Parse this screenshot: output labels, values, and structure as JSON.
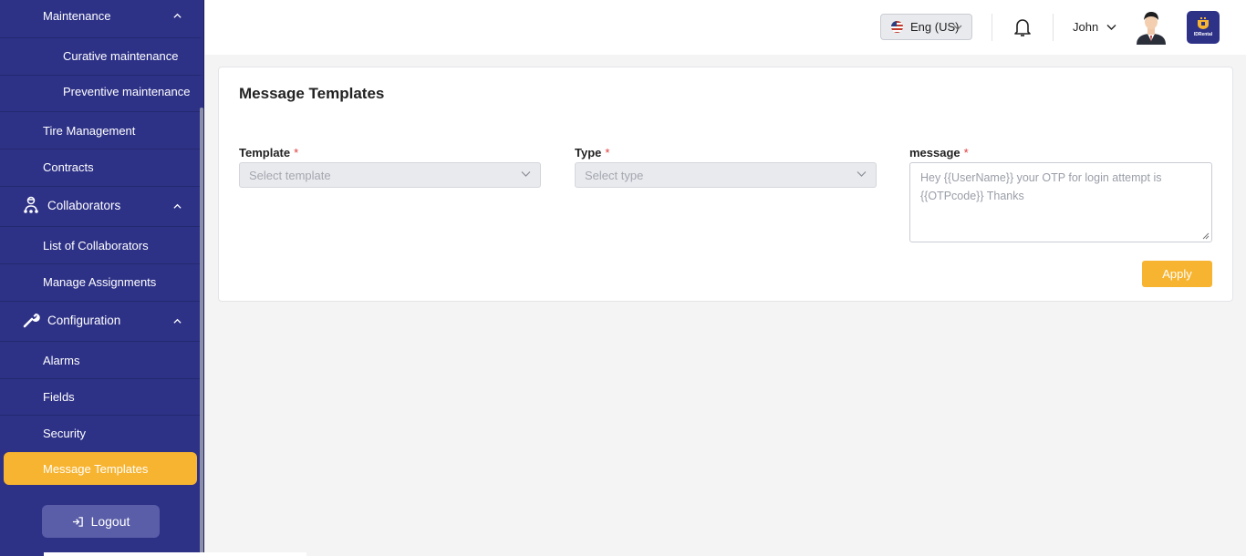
{
  "sidebar": {
    "maintenance": {
      "label": "Maintenance",
      "items": [
        "Curative maintenance",
        "Preventive maintenance"
      ]
    },
    "tire_management": "Tire Management",
    "contracts": "Contracts",
    "collaborators": {
      "label": "Collaborators",
      "items": [
        "List of Collaborators",
        "Manage Assignments"
      ]
    },
    "configuration": {
      "label": "Configuration",
      "items": [
        "Alarms",
        "Fields",
        "Security",
        "Message Templates"
      ]
    },
    "active_item": "Message Templates",
    "logout_label": "Logout",
    "active_color": "#f7b430",
    "background_color": "#2e3287"
  },
  "header": {
    "language": "Eng (US)",
    "user_name": "John",
    "brand": "IDRental"
  },
  "card": {
    "title": "Message Templates",
    "template": {
      "label": "Template",
      "required": "*",
      "placeholder": "Select template"
    },
    "type": {
      "label": "Type",
      "required": "*",
      "placeholder": "Select type"
    },
    "message": {
      "label": "message",
      "required": "*",
      "placeholder": "Hey {{UserName}} your OTP for login attempt is {{OTPcode}} Thanks"
    },
    "apply_label": "Apply"
  }
}
